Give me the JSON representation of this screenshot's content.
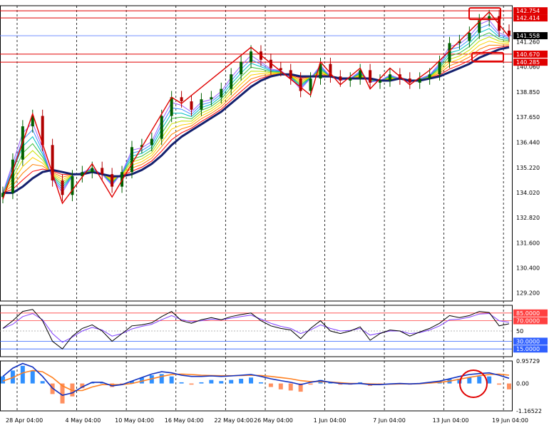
{
  "chart_data": {
    "type": "line",
    "main_panel": {
      "price_axis_ticks": [
        "141.260",
        "140.060",
        "138.850",
        "137.650",
        "136.440",
        "135.220",
        "134.020",
        "132.820",
        "131.600",
        "130.400",
        "129.200"
      ],
      "current_price": "141.558",
      "price_tags": [
        {
          "label": "142.754",
          "color": "#e00000"
        },
        {
          "label": "142.414",
          "color": "#e00000"
        },
        {
          "label": "140.670",
          "color": "#e00000"
        },
        {
          "label": "140.285",
          "color": "#e00000"
        }
      ],
      "ylim": [
        128.8,
        143.0
      ],
      "ma_ribbon_colors": [
        "#ff0000",
        "#ff7f00",
        "#ffd000",
        "#c8e000",
        "#40c040",
        "#00c0c0",
        "#4090ff",
        "#a060ff"
      ],
      "closes": [
        {
          "t": "28 Apr 04:00",
          "v": 134.0
        },
        {
          "t": "29 Apr",
          "v": 135.6
        },
        {
          "t": "30 Apr",
          "v": 137.2
        },
        {
          "t": "1 May",
          "v": 137.7
        },
        {
          "t": "2 May",
          "v": 136.3
        },
        {
          "t": "3 May",
          "v": 134.6
        },
        {
          "t": "4 May 04:00",
          "v": 133.9
        },
        {
          "t": "5 May",
          "v": 134.8
        },
        {
          "t": "6 May",
          "v": 135.0
        },
        {
          "t": "7 May",
          "v": 135.2
        },
        {
          "t": "9 May",
          "v": 134.9
        },
        {
          "t": "10 May 04:00",
          "v": 134.3
        },
        {
          "t": "11 May",
          "v": 135.0
        },
        {
          "t": "12 May",
          "v": 136.2
        },
        {
          "t": "13 May",
          "v": 136.3
        },
        {
          "t": "14 May",
          "v": 136.6
        },
        {
          "t": "16 May 04:00",
          "v": 137.7
        },
        {
          "t": "17 May",
          "v": 138.6
        },
        {
          "t": "18 May",
          "v": 138.4
        },
        {
          "t": "19 May",
          "v": 138.0
        },
        {
          "t": "20 May",
          "v": 138.5
        },
        {
          "t": "22 May 04:00",
          "v": 138.6
        },
        {
          "t": "23 May",
          "v": 139.0
        },
        {
          "t": "24 May",
          "v": 139.7
        },
        {
          "t": "25 May",
          "v": 140.3
        },
        {
          "t": "26 May 04:00",
          "v": 140.8
        },
        {
          "t": "27 May",
          "v": 140.4
        },
        {
          "t": "28 May",
          "v": 140.0
        },
        {
          "t": "29 May",
          "v": 139.9
        },
        {
          "t": "30 May",
          "v": 139.5
        },
        {
          "t": "31 May",
          "v": 138.9
        },
        {
          "t": "1 Jun 04:00",
          "v": 139.5
        },
        {
          "t": "2 Jun",
          "v": 140.2
        },
        {
          "t": "3 Jun",
          "v": 139.6
        },
        {
          "t": "4 Jun",
          "v": 139.4
        },
        {
          "t": "5 Jun",
          "v": 139.5
        },
        {
          "t": "6 Jun",
          "v": 139.9
        },
        {
          "t": "7 Jun 04:00",
          "v": 139.3
        },
        {
          "t": "8 Jun",
          "v": 139.4
        },
        {
          "t": "9 Jun",
          "v": 139.7
        },
        {
          "t": "10 Jun",
          "v": 139.5
        },
        {
          "t": "11 Jun",
          "v": 139.3
        },
        {
          "t": "12 Jun",
          "v": 139.5
        },
        {
          "t": "13 Jun 04:00",
          "v": 139.7
        },
        {
          "t": "14 Jun",
          "v": 140.3
        },
        {
          "t": "15 Jun",
          "v": 141.2
        },
        {
          "t": "16 Jun",
          "v": 141.3
        },
        {
          "t": "17 Jun",
          "v": 141.7
        },
        {
          "t": "18 Jun",
          "v": 142.3
        },
        {
          "t": "19 Jun 04:00",
          "v": 142.5
        },
        {
          "t": "20 Jun",
          "v": 141.8
        },
        {
          "t": "21 Jun",
          "v": 141.56
        }
      ],
      "base_ma": [
        134.0,
        134.0,
        134.3,
        134.7,
        135.0,
        135.1,
        135.0,
        134.9,
        134.9,
        135.0,
        134.9,
        134.8,
        134.8,
        134.9,
        135.1,
        135.4,
        135.8,
        136.3,
        136.7,
        137.0,
        137.3,
        137.6,
        137.9,
        138.3,
        138.7,
        139.1,
        139.4,
        139.6,
        139.7,
        139.7,
        139.6,
        139.6,
        139.6,
        139.6,
        139.5,
        139.5,
        139.5,
        139.5,
        139.4,
        139.4,
        139.5,
        139.4,
        139.4,
        139.5,
        139.6,
        139.8,
        140.0,
        140.2,
        140.5,
        140.7,
        140.9,
        141.0
      ],
      "zigzag": [
        {
          "i": 0,
          "v": 133.7
        },
        {
          "i": 3,
          "v": 137.8
        },
        {
          "i": 6,
          "v": 133.5
        },
        {
          "i": 9,
          "v": 135.4
        },
        {
          "i": 11,
          "v": 133.8
        },
        {
          "i": 17,
          "v": 138.6
        },
        {
          "i": 18,
          "v": 138.3
        },
        {
          "i": 25,
          "v": 141.0
        },
        {
          "i": 31,
          "v": 138.7
        },
        {
          "i": 32,
          "v": 140.3
        },
        {
          "i": 34,
          "v": 139.2
        },
        {
          "i": 36,
          "v": 140.0
        },
        {
          "i": 37,
          "v": 139.0
        },
        {
          "i": 39,
          "v": 140.0
        },
        {
          "i": 41,
          "v": 139.2
        },
        {
          "i": 43,
          "v": 139.9
        },
        {
          "i": 46,
          "v": 141.3
        },
        {
          "i": 49,
          "v": 142.7
        },
        {
          "i": 51,
          "v": 141.5
        }
      ]
    },
    "oscillator_panel": {
      "levels": [
        {
          "label": "85.0000",
          "value": 85,
          "color": "#ff4040",
          "tag": true
        },
        {
          "label": "70.0000",
          "value": 70,
          "color": "#ff4040",
          "tag": true
        },
        {
          "label": "50",
          "value": 50,
          "color": "#a0a0a0",
          "tag": false
        },
        {
          "label": "30.0000",
          "value": 30,
          "color": "#3060ff",
          "tag": true
        },
        {
          "label": "15.0000",
          "value": 15,
          "color": "#3060ff",
          "tag": true
        }
      ],
      "ylim": [
        0,
        100
      ],
      "main_line": [
        55,
        70,
        88,
        92,
        70,
        30,
        15,
        40,
        55,
        62,
        50,
        30,
        45,
        60,
        62,
        66,
        78,
        88,
        70,
        65,
        72,
        76,
        72,
        78,
        82,
        85,
        70,
        60,
        55,
        52,
        35,
        55,
        70,
        50,
        45,
        50,
        58,
        32,
        45,
        52,
        50,
        40,
        48,
        55,
        65,
        80,
        76,
        80,
        88,
        86,
        60,
        64
      ],
      "signal_line": [
        55,
        63,
        78,
        84,
        72,
        45,
        28,
        38,
        50,
        57,
        52,
        40,
        45,
        54,
        59,
        63,
        72,
        80,
        72,
        68,
        70,
        73,
        72,
        75,
        78,
        81,
        73,
        65,
        59,
        55,
        45,
        52,
        62,
        55,
        50,
        51,
        55,
        42,
        46,
        50,
        50,
        45,
        47,
        52,
        60,
        72,
        73,
        77,
        83,
        84,
        70,
        67
      ]
    },
    "macd_panel": {
      "ticks": [
        "0.95729",
        "0.00",
        "-1.16522"
      ],
      "ylim": [
        -1.16522,
        0.95729
      ],
      "histogram": [
        0.3,
        0.55,
        0.75,
        0.55,
        0.1,
        -0.45,
        -0.85,
        -0.55,
        -0.2,
        0.05,
        0.05,
        -0.15,
        -0.05,
        0.1,
        0.25,
        0.35,
        0.4,
        0.3,
        0.05,
        -0.05,
        0.05,
        0.15,
        0.1,
        0.15,
        0.2,
        0.25,
        0.05,
        -0.15,
        -0.25,
        -0.3,
        -0.35,
        -0.05,
        0.15,
        0.05,
        -0.05,
        -0.05,
        0.05,
        -0.1,
        -0.05,
        0.0,
        0.0,
        -0.05,
        0.0,
        0.05,
        0.1,
        0.2,
        0.2,
        0.25,
        0.3,
        0.3,
        -0.05,
        -0.25
      ],
      "macd_line": [
        0.3,
        0.65,
        0.85,
        0.7,
        0.3,
        -0.2,
        -0.5,
        -0.4,
        -0.15,
        0.05,
        0.05,
        -0.1,
        -0.05,
        0.1,
        0.25,
        0.4,
        0.5,
        0.45,
        0.35,
        0.3,
        0.3,
        0.32,
        0.3,
        0.32,
        0.35,
        0.38,
        0.3,
        0.2,
        0.12,
        0.05,
        -0.05,
        0.05,
        0.12,
        0.05,
        0.0,
        -0.02,
        0.0,
        -0.05,
        -0.05,
        -0.02,
        0.0,
        -0.02,
        0.0,
        0.05,
        0.1,
        0.2,
        0.3,
        0.38,
        0.42,
        0.45,
        0.35,
        0.22
      ],
      "signal_line": [
        0.1,
        0.25,
        0.45,
        0.55,
        0.5,
        0.25,
        -0.1,
        -0.3,
        -0.3,
        -0.15,
        -0.05,
        -0.05,
        -0.05,
        0.0,
        0.1,
        0.2,
        0.3,
        0.38,
        0.4,
        0.38,
        0.35,
        0.34,
        0.33,
        0.33,
        0.34,
        0.35,
        0.34,
        0.3,
        0.25,
        0.2,
        0.12,
        0.08,
        0.08,
        0.06,
        0.03,
        0.0,
        0.0,
        -0.02,
        -0.03,
        -0.03,
        -0.02,
        -0.02,
        -0.01,
        0.02,
        0.05,
        0.1,
        0.18,
        0.26,
        0.33,
        0.38,
        0.4,
        0.35
      ],
      "macd_color": "#1030c0",
      "signal_color": "#ff8020",
      "hist_pos_color": "#3090ff",
      "hist_neg_color": "#ff9060"
    },
    "x_axis_labels": [
      "28 Apr 04:00",
      "4 May 04:00",
      "10 May 04:00",
      "16 May 04:00",
      "22 May 04:00",
      "26 May 04:00",
      "1 Jun 04:00",
      "7 Jun 04:00",
      "13 Jun 04:00",
      "19 Jun 04:00"
    ]
  }
}
